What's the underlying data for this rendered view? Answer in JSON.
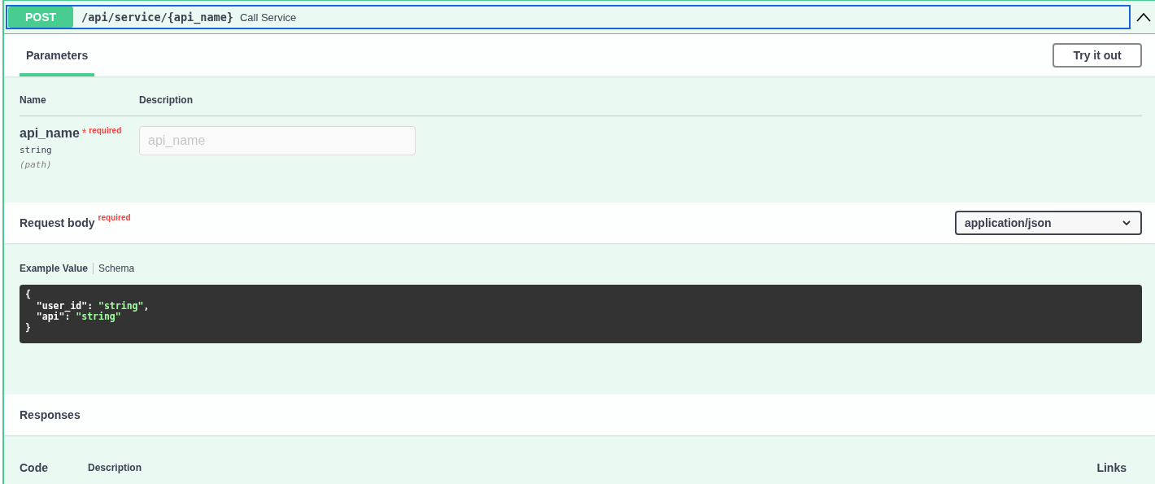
{
  "operation": {
    "method": "POST",
    "path": "/api/service/{api_name}",
    "summary": "Call Service",
    "expanded": true
  },
  "tabs": [
    {
      "label": "Parameters",
      "selected": true
    }
  ],
  "try_button": "Try it out",
  "parameters": {
    "columns": [
      "Name",
      "Description"
    ],
    "rows": [
      {
        "name": "api_name",
        "required_mark": "*",
        "required_label": "required",
        "type": "string",
        "location": "(path)",
        "placeholder": "api_name"
      }
    ]
  },
  "request_body": {
    "title": "Request body",
    "required_label": "required",
    "content_type": "application/json",
    "view_tabs": [
      {
        "label": "Example Value",
        "selected": true
      },
      {
        "label": "Schema",
        "selected": false
      }
    ],
    "code_lines": [
      {
        "indented": false,
        "tokens": [
          {
            "kind": "punct",
            "text": "{"
          }
        ]
      },
      {
        "indented": true,
        "tokens": [
          {
            "kind": "key",
            "text": "\"user_id\""
          },
          {
            "kind": "punct",
            "text": ": "
          },
          {
            "kind": "string",
            "text": "\"string\""
          },
          {
            "kind": "punct",
            "text": ","
          }
        ]
      },
      {
        "indented": true,
        "tokens": [
          {
            "kind": "key",
            "text": "\"api\""
          },
          {
            "kind": "punct",
            "text": ": "
          },
          {
            "kind": "string",
            "text": "\"string\""
          }
        ]
      },
      {
        "indented": false,
        "tokens": [
          {
            "kind": "punct",
            "text": "}"
          }
        ]
      }
    ]
  },
  "responses": {
    "title": "Responses",
    "columns": [
      "Code",
      "Description",
      "Links"
    ]
  }
}
